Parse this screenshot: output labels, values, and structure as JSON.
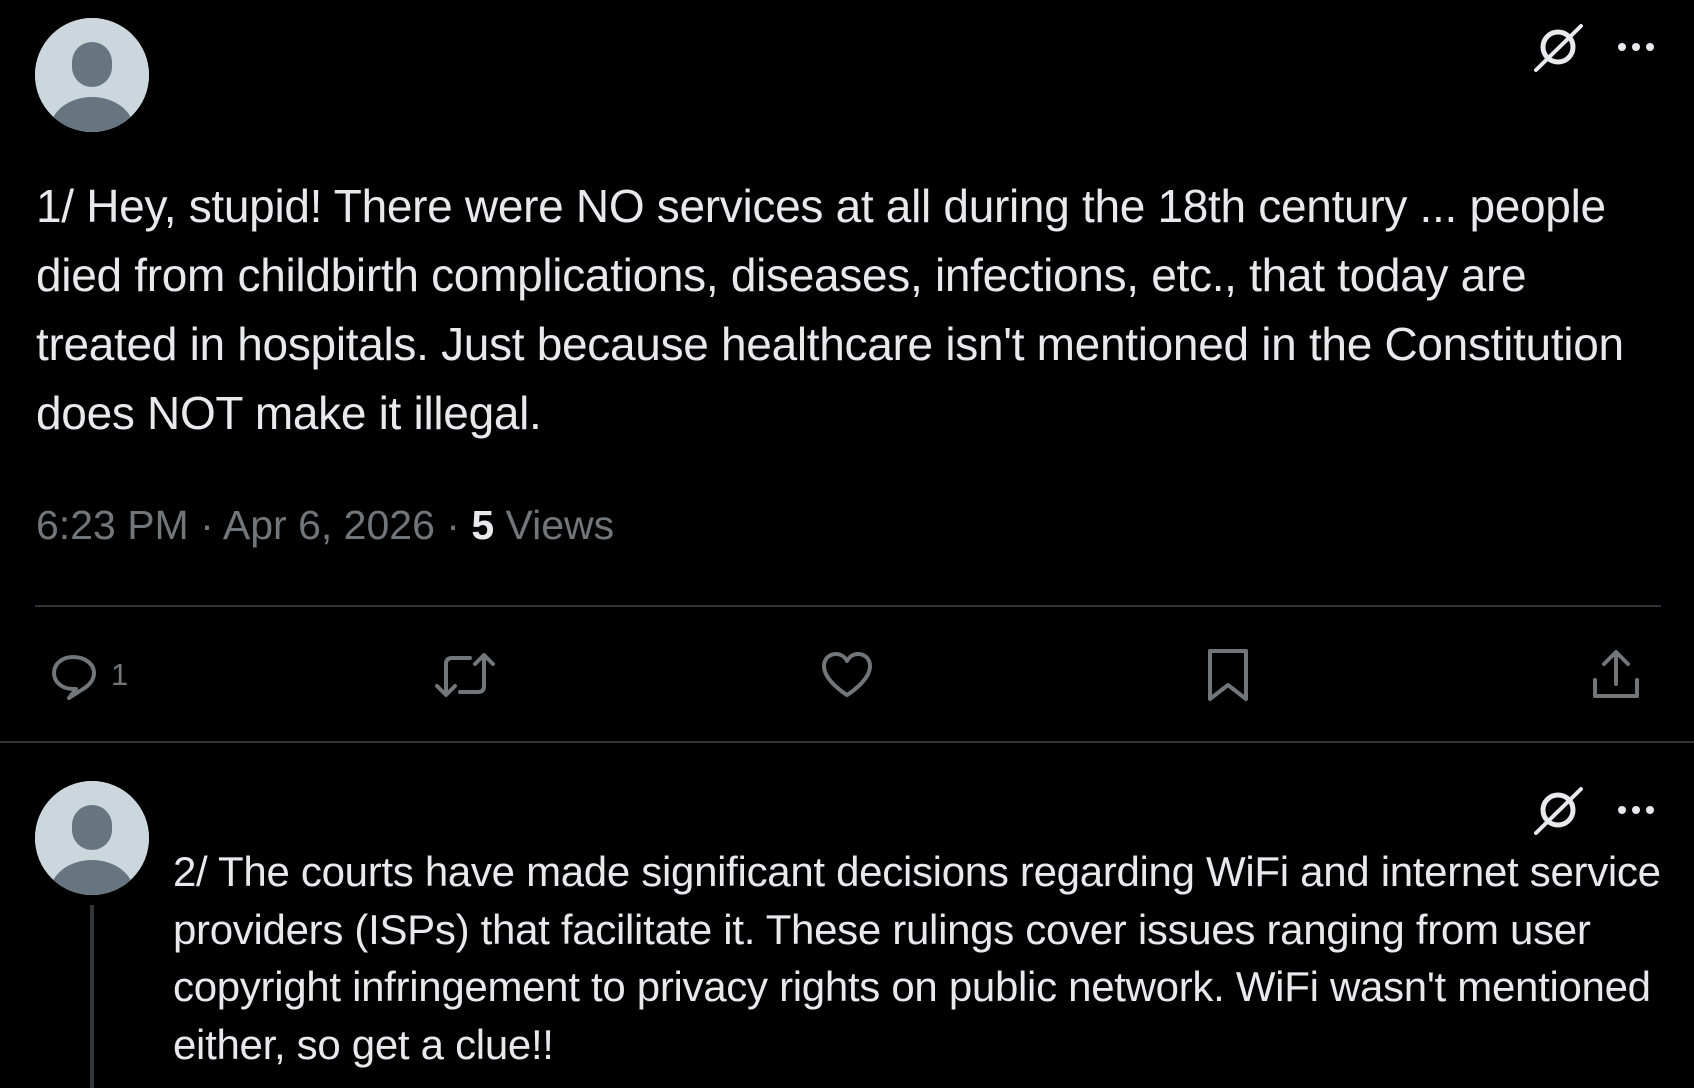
{
  "tweet1": {
    "text": "1/ Hey, stupid! There were NO services at all during the 18th century ... people died from childbirth complications, diseases, infections, etc., that today are treated in hospitals. Just because healthcare isn't mentioned in the Constitution does NOT make it illegal.",
    "time": "6:23 PM",
    "separator1": " · ",
    "date": "Apr 6, 2026",
    "separator2": " · ",
    "views_count": "5",
    "views_label": " Views",
    "reply_count": "1",
    "icons": {
      "corner": [
        "grok-icon",
        "more-icon"
      ],
      "actions": [
        "reply-icon",
        "retweet-icon",
        "like-icon",
        "bookmark-icon",
        "share-icon"
      ]
    }
  },
  "tweet2": {
    "text": "2/ The courts have made significant decisions regarding WiFi and internet service providers (ISPs) that facilitate it. These rulings cover issues ranging from user copyright infringement to privacy rights on public network. WiFi wasn't mentioned either, so get a clue!!",
    "icons": {
      "corner": [
        "grok-icon",
        "more-icon"
      ]
    }
  },
  "colors": {
    "background": "#000000",
    "text_primary": "#e7e9ea",
    "text_secondary": "#71767b",
    "border": "#2f3336",
    "avatar_bg": "#ccd6dd",
    "avatar_figure": "#66757f"
  }
}
